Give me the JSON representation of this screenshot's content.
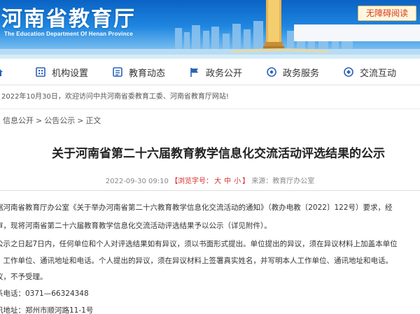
{
  "header": {
    "site_name": "河南省教育厅",
    "site_subtitle": "The Education Department Of Henan Province",
    "accessibility_button": "无障碍阅读"
  },
  "nav": {
    "items": [
      {
        "label": "",
        "icon": "home-icon"
      },
      {
        "label": "机构设置",
        "icon": "organization-icon"
      },
      {
        "label": "教育动态",
        "icon": "news-icon"
      },
      {
        "label": "政务公开",
        "icon": "flag-icon"
      },
      {
        "label": "政务服务",
        "icon": "service-icon"
      },
      {
        "label": "交流互动",
        "icon": "interaction-icon"
      }
    ]
  },
  "notice": {
    "text": "2022年10月30日，欢迎访问中共河南省委教育工委、河南省教育厅网站!"
  },
  "breadcrumb": {
    "items": [
      "信息公开",
      "公告公示"
    ],
    "separator": ">",
    "current": "正文"
  },
  "article": {
    "title": "关于河南省第二十六届教育教学信息化交流活动评选结果的公示",
    "meta": {
      "date": "2022-09-30 09:10",
      "font_label_open": "【浏览字号：",
      "font_sizes": [
        "大",
        "中",
        "小"
      ],
      "font_label_close": "】",
      "source": "来源：教育厅办公室"
    },
    "paragraphs": [
      "据河南省教育厅办公室《关于举办河南省第二十六教育教学信息化交流活动的通知》（教办电教〔2022〕122号）要求，经",
      "审，现将河南省第二十六届教育教学信息化交流活动评选结果予以公示（详见附件）。",
      "公示之日起7日内，任何单位和个人对评选结果如有异议，须以书面形式提出。单位提出的异议，须在异议材料上加盖本单位",
      "、工作单位、通讯地址和电话。个人提出的异议，须在异议材料上签署真实姓名，并写明本人工作单位、通讯地址和电话。",
      "议，不予受理。",
      "系电话：0371—66324348",
      "讯地址：郑州市顺河路11-1号"
    ]
  },
  "colors": {
    "header_blue": "#1f86e0",
    "accessibility_text": "#d83b17",
    "meta_red": "#d72c2c"
  }
}
